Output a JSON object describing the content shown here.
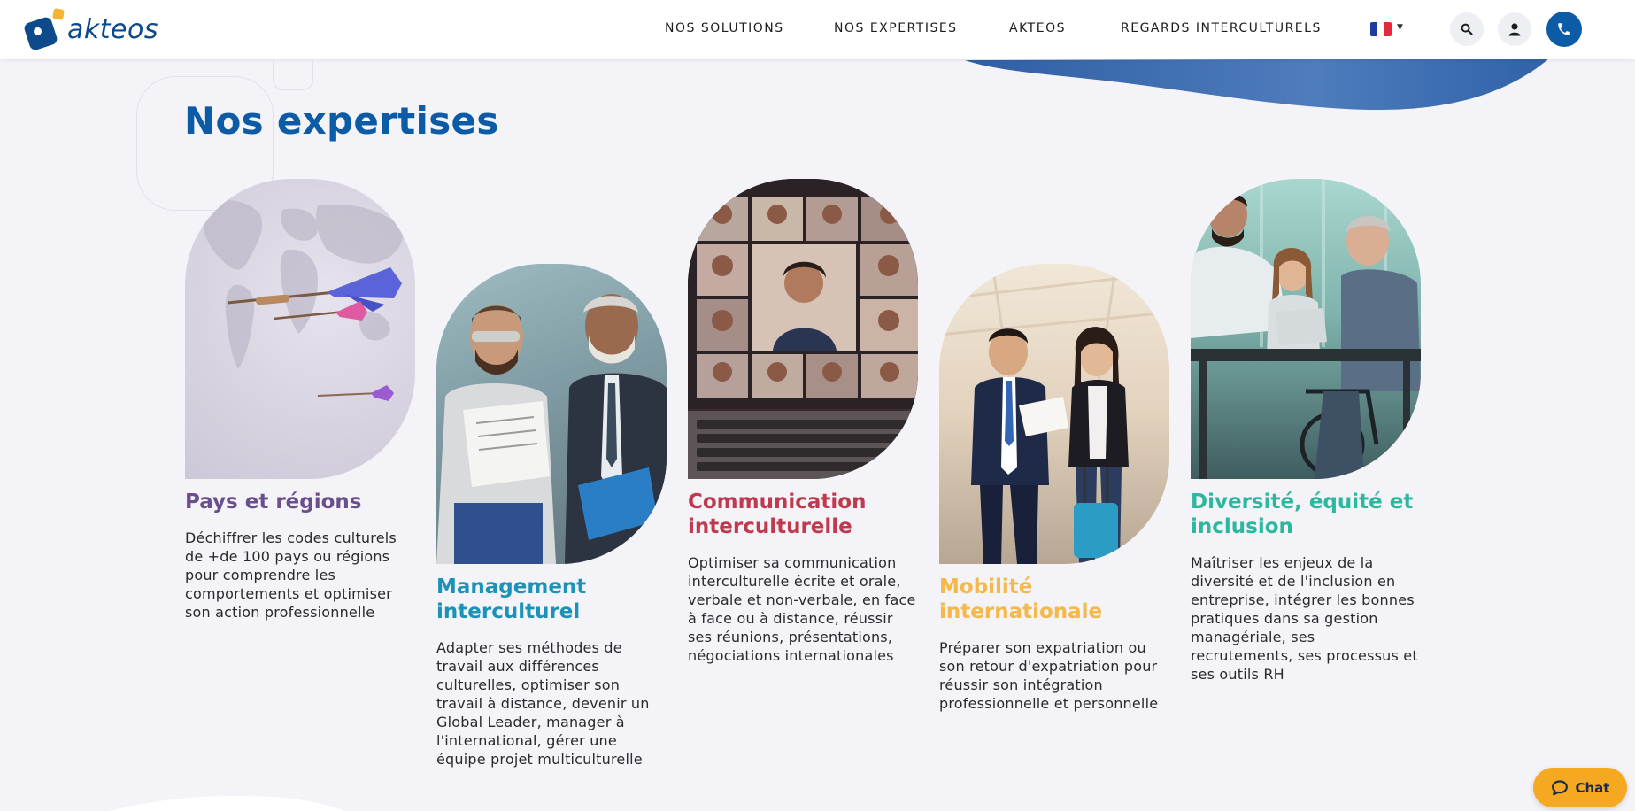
{
  "brand": {
    "name": "akteos",
    "primary": "#0c5ba6",
    "accent": "#f5b530"
  },
  "nav": {
    "items": [
      {
        "label": "NOS SOLUTIONS"
      },
      {
        "label": "NOS EXPERTISES"
      },
      {
        "label": "AKTEOS"
      },
      {
        "label": "REGARDS INTERCULTURELS"
      }
    ],
    "language_flag": "flag-fr-icon",
    "icons": [
      "search-icon",
      "user-icon",
      "phone-icon"
    ]
  },
  "page_title": "Nos expertises",
  "cards": [
    {
      "title": "Pays et régions",
      "title_color": "#6a4f8e",
      "description": "Déchiffrer les codes culturels de +de 100 pays ou régions pour comprendre les comportements et optimiser son action professionnelle",
      "image": "darts-on-world-map"
    },
    {
      "title": "Management interculturel",
      "title_color": "#1b92b8",
      "description": "Adapter ses méthodes de travail aux différences culturelles, optimiser son travail à distance, devenir un Global Leader, manager à l'international, gérer une équipe projet multiculturelle",
      "image": "engineers-reviewing-document"
    },
    {
      "title": "Communication interculturelle",
      "title_color": "#c0394f",
      "description": "Optimiser sa communication interculturelle écrite et orale, verbale et non-verbale, en face à face ou à distance, réussir ses réunions, présentations, négociations internationales",
      "image": "video-conference-laptop"
    },
    {
      "title": "Mobilité internationale",
      "title_color": "#f5b84a",
      "description": "Préparer son expatriation ou son retour d'expatriation pour réussir son intégration professionnelle et personnelle",
      "image": "business-travelers-airport"
    },
    {
      "title": "Diversité, équité et inclusion",
      "title_color": "#2bb89f",
      "description": "Maîtriser les enjeux de la diversité et de l'inclusion en entreprise, intégrer les bonnes pratiques dans sa gestion managériale, ses recrutements, ses processus et ses outils RH",
      "image": "diverse-team-meeting"
    }
  ],
  "chat": {
    "label": "Chat",
    "color": "#f5a921"
  }
}
